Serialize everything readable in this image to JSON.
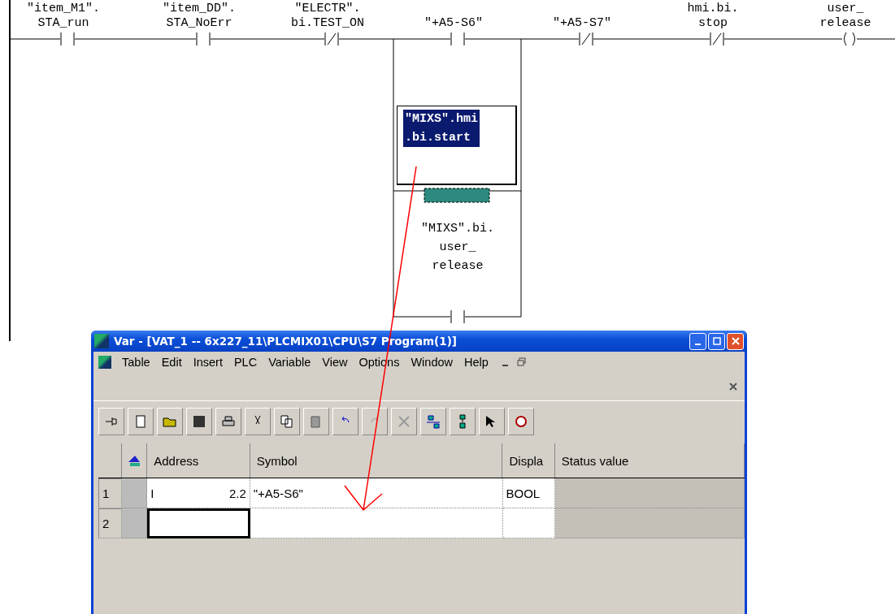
{
  "ladder": {
    "contacts": [
      {
        "kind": "no",
        "label": [
          "\"item_M1\".",
          "STA_run"
        ]
      },
      {
        "kind": "no",
        "label": [
          "\"item_DD\".",
          "STA_NoErr"
        ]
      },
      {
        "kind": "nc",
        "label": [
          "\"ELECTR\".",
          "bi.TEST_ON"
        ]
      },
      {
        "kind": "no",
        "label": [
          "\"+A5-S6\""
        ]
      },
      {
        "kind": "nc",
        "label": [
          "\"+A5-S7\""
        ]
      },
      {
        "kind": "nc",
        "label": [
          "hmi.bi.",
          "stop"
        ]
      },
      {
        "kind": "coil",
        "label": [
          "user_",
          "release"
        ]
      }
    ],
    "branch": {
      "edit_text": [
        "\"MIXS\".hmi",
        ".bi.start"
      ],
      "contact": {
        "kind": "no",
        "label": [
          "\"MIXS\".bi.",
          "user_",
          "release"
        ]
      }
    }
  },
  "window": {
    "title": "Var - [VAT_1 -- 6x227_11\\PLCMIX01\\CPU\\S7 Program(1)]",
    "menu": [
      "Table",
      "Edit",
      "Insert",
      "PLC",
      "Variable",
      "View",
      "Options",
      "Window",
      "Help"
    ],
    "table": {
      "columns": [
        "Address",
        "Symbol",
        "Displa",
        "Status value"
      ],
      "rows": [
        {
          "number": "1",
          "operand": "I",
          "address": "2.2",
          "symbol": "\"+A5-S6\"",
          "format": "BOOL",
          "selected": false
        },
        {
          "number": "2",
          "selected": true
        }
      ]
    }
  }
}
